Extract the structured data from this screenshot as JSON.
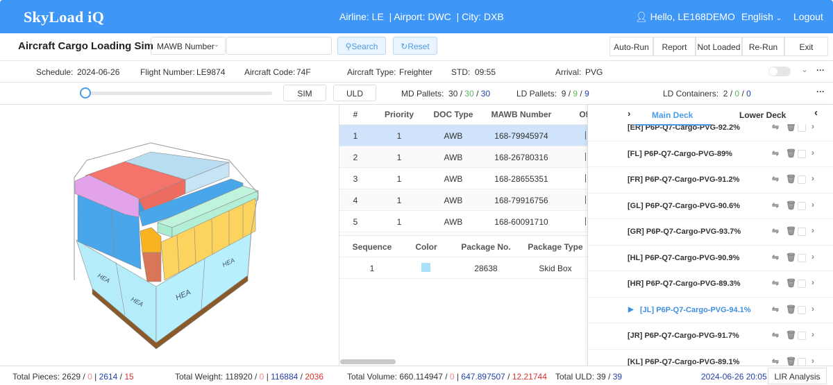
{
  "header": {
    "logo": "SkyLoad iQ",
    "context": "Airline: LE  | Airport: DWC  | City: DXB",
    "user": "Hello, LE168DEMO",
    "language": "English",
    "logout": "Logout",
    "brand_color": "#3e97f6"
  },
  "toolbar": {
    "title": "Aircraft Cargo Loading Simu",
    "search_field": "MAWB Number",
    "search_value": "",
    "search": "Search",
    "reset": "Reset",
    "actions": [
      "Auto-Run",
      "Report",
      "Not Loaded",
      "Re-Run",
      "Exit"
    ]
  },
  "flight": {
    "schedule_label": "Schedule:",
    "schedule": "2024-06-26",
    "flight_label": "Flight Number:",
    "flight": "LE9874",
    "code_label": "Aircraft Code:",
    "code": "74F",
    "type_label": "Aircraft Type:",
    "type": "Freighter",
    "std_label": "STD:",
    "std": "09:55",
    "arrival_label": "Arrival:",
    "arrival": "PVG",
    "toggle_on": false
  },
  "controls": {
    "slider_value": 0,
    "sim": "SIM",
    "uld": "ULD",
    "md_label": "MD Pallets:",
    "md": [
      "30",
      "30",
      "30"
    ],
    "ldp_label": "LD Pallets:",
    "ldp": [
      "9",
      "9",
      "9"
    ],
    "ldc_label": "LD Containers:",
    "ldc": [
      "2",
      "0",
      "0"
    ]
  },
  "viz": {
    "labels": [
      "HEA",
      "HEA",
      "HEA",
      "HEA"
    ]
  },
  "awb_table": {
    "headers": [
      "#",
      "Priority",
      "DOC Type",
      "MAWB Number",
      "Of"
    ],
    "rows": [
      [
        "1",
        "1",
        "AWB",
        "168-79945974"
      ],
      [
        "2",
        "1",
        "AWB",
        "168-26780316"
      ],
      [
        "3",
        "1",
        "AWB",
        "168-28655351"
      ],
      [
        "4",
        "1",
        "AWB",
        "168-79916756"
      ],
      [
        "5",
        "1",
        "AWB",
        "168-60091710"
      ]
    ],
    "selected": 0
  },
  "package_table": {
    "headers": [
      "Sequence",
      "Color",
      "Package No.",
      "Package Type"
    ],
    "rows": [
      {
        "seq": "1",
        "color": "#a8e2f8",
        "no": "28638",
        "type": "Skid Box"
      }
    ]
  },
  "deck_panel": {
    "tabs": [
      "Main Deck",
      "Lower Deck"
    ],
    "active": 0,
    "items": [
      "[ER] P6P-Q7-Cargo-PVG-92.2%",
      "[FL] P6P-Q7-Cargo-PVG-89%",
      "[FR] P6P-Q7-Cargo-PVG-91.2%",
      "[GL] P6P-Q7-Cargo-PVG-90.6%",
      "[GR] P6P-Q7-Cargo-PVG-93.7%",
      "[HL] P6P-Q7-Cargo-PVG-90.9%",
      "[HR] P6P-Q7-Cargo-PVG-89.3%",
      "[JL] P6P-Q7-Cargo-PVG-94.1%",
      "[JR] P6P-Q7-Cargo-PVG-91.7%",
      "[KL] P6P-Q7-Cargo-PVG-89.1%"
    ],
    "selected": 7
  },
  "footer": {
    "pieces_label": "Total Pieces:",
    "pieces": [
      "2629",
      "0",
      "2614",
      "15"
    ],
    "weight_label": "Total Weight:",
    "weight": [
      "118920",
      "0",
      "116884",
      "2036"
    ],
    "volume_label": "Total Volume:",
    "volume": [
      "660.114947",
      "0",
      "647.897507",
      "12.21744"
    ],
    "uld_label": "Total ULD:",
    "uld": [
      "39",
      "39"
    ],
    "datetime": "2024-06-26 20:05",
    "lir": "LIR Analysis"
  }
}
